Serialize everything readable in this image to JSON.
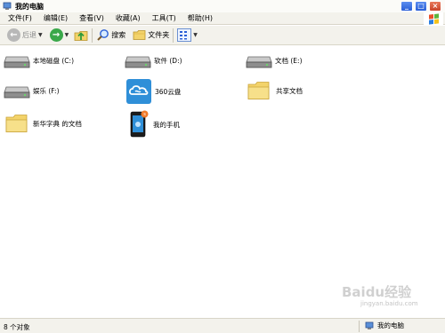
{
  "window": {
    "title": "我的电脑"
  },
  "menu": [
    "文件(F)",
    "编辑(E)",
    "查看(V)",
    "收藏(A)",
    "工具(T)",
    "帮助(H)"
  ],
  "toolbar": {
    "back": "后退",
    "search": "搜索",
    "folders": "文件夹"
  },
  "items": [
    {
      "label": "本地磁盘 (C:)",
      "icon": "hard-drive-icon"
    },
    {
      "label": "软件 (D:)",
      "icon": "hard-drive-icon"
    },
    {
      "label": "文档 (E:)",
      "icon": "hard-drive-icon"
    },
    {
      "label": "娱乐 (F:)",
      "icon": "hard-drive-icon"
    },
    {
      "label": "360云盘",
      "icon": "cloud-disk-icon"
    },
    {
      "label": "共享文档",
      "icon": "folder-icon"
    },
    {
      "label": "新华字典 的文档",
      "icon": "folder-icon"
    },
    {
      "label": "我的手机",
      "icon": "phone-icon"
    }
  ],
  "status": {
    "count": "8 个对象",
    "location": "我的电脑"
  },
  "watermark": {
    "brand": "Baidu经验",
    "url": "jingyan.baidu.com"
  },
  "colors": {
    "accent": "#2a5fd6",
    "go": "#3aa84a",
    "folder": "#f3d36a",
    "cloud": "#2f8fd8"
  }
}
